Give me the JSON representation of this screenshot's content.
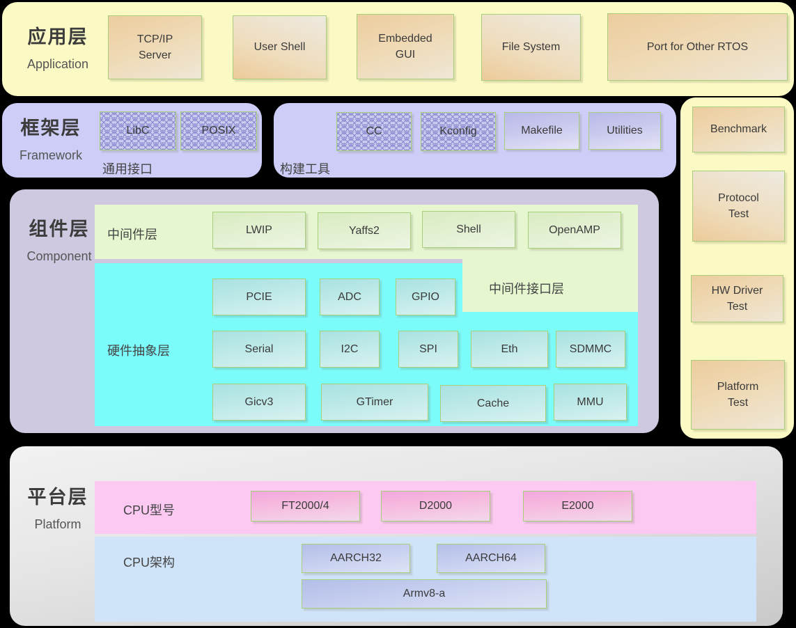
{
  "diagram": {
    "title": "Embedded software stack layered architecture"
  },
  "layers": {
    "application": {
      "cn": "应用层",
      "en": "Application"
    },
    "framework": {
      "cn": "框架层",
      "en": "Framework"
    },
    "component": {
      "cn": "组件层",
      "en": "Component"
    },
    "platform": {
      "cn": "平台层",
      "en": "Platform"
    }
  },
  "application": {
    "boxes": [
      {
        "label": "TCP/IP\nServer"
      },
      {
        "label": "User Shell"
      },
      {
        "label": "Embedded\nGUI"
      },
      {
        "label": "File System"
      },
      {
        "label": "Port for Other RTOS"
      }
    ]
  },
  "framework": {
    "common_interface_label": "通用接口",
    "build_tools_label": "构建工具",
    "common_boxes": [
      {
        "label": "LibC",
        "style": "hatch"
      },
      {
        "label": "POSIX",
        "style": "hatch"
      }
    ],
    "build_boxes": [
      {
        "label": "CC",
        "style": "hatch"
      },
      {
        "label": "Kconfig",
        "style": "hatch"
      },
      {
        "label": "Makefile",
        "style": "solid"
      },
      {
        "label": "Utilities",
        "style": "solid"
      }
    ]
  },
  "test_column": {
    "boxes": [
      {
        "label": "Benchmark"
      },
      {
        "label": "Protocol\nTest"
      },
      {
        "label": "HW Driver\nTest"
      },
      {
        "label": "Platform\nTest"
      }
    ]
  },
  "component": {
    "middleware_label": "中间件层",
    "middleware_interface_label": "中间件接口层",
    "hal_label": "硬件抽象层",
    "middleware_boxes": [
      {
        "label": "LWIP"
      },
      {
        "label": "Yaffs2"
      },
      {
        "label": "Shell"
      },
      {
        "label": "OpenAMP"
      }
    ],
    "hal_row1": [
      {
        "label": "PCIE"
      },
      {
        "label": "ADC"
      },
      {
        "label": "GPIO"
      }
    ],
    "hal_row2": [
      {
        "label": "Serial"
      },
      {
        "label": "I2C"
      },
      {
        "label": "SPI"
      },
      {
        "label": "Eth"
      },
      {
        "label": "SDMMC"
      }
    ],
    "hal_row3": [
      {
        "label": "Gicv3"
      },
      {
        "label": "GTimer"
      },
      {
        "label": "Cache"
      },
      {
        "label": "MMU"
      }
    ]
  },
  "platform": {
    "cpu_model_label": "CPU型号",
    "cpu_arch_label": "CPU架构",
    "cpu_models": [
      {
        "label": "FT2000/4"
      },
      {
        "label": "D2000"
      },
      {
        "label": "E2000"
      }
    ],
    "cpu_arch_row1": [
      {
        "label": "AARCH32"
      },
      {
        "label": "AARCH64"
      }
    ],
    "cpu_arch_row2": [
      {
        "label": "Armv8-a"
      }
    ]
  },
  "colors": {
    "application_bg": "#fcfac4",
    "framework_bg": "#cdcdf7",
    "component_bg": "#cec9e0",
    "middleware_bg": "#e6f7cf",
    "hal_bg": "#7cfbfb",
    "platform_bg": "#e6e6e6",
    "cpu_model_bg": "#fbc9f2",
    "cpu_arch_bg": "#cfe3f9",
    "test_bg": "#fcfac4",
    "node_border": "#a8d07a"
  }
}
